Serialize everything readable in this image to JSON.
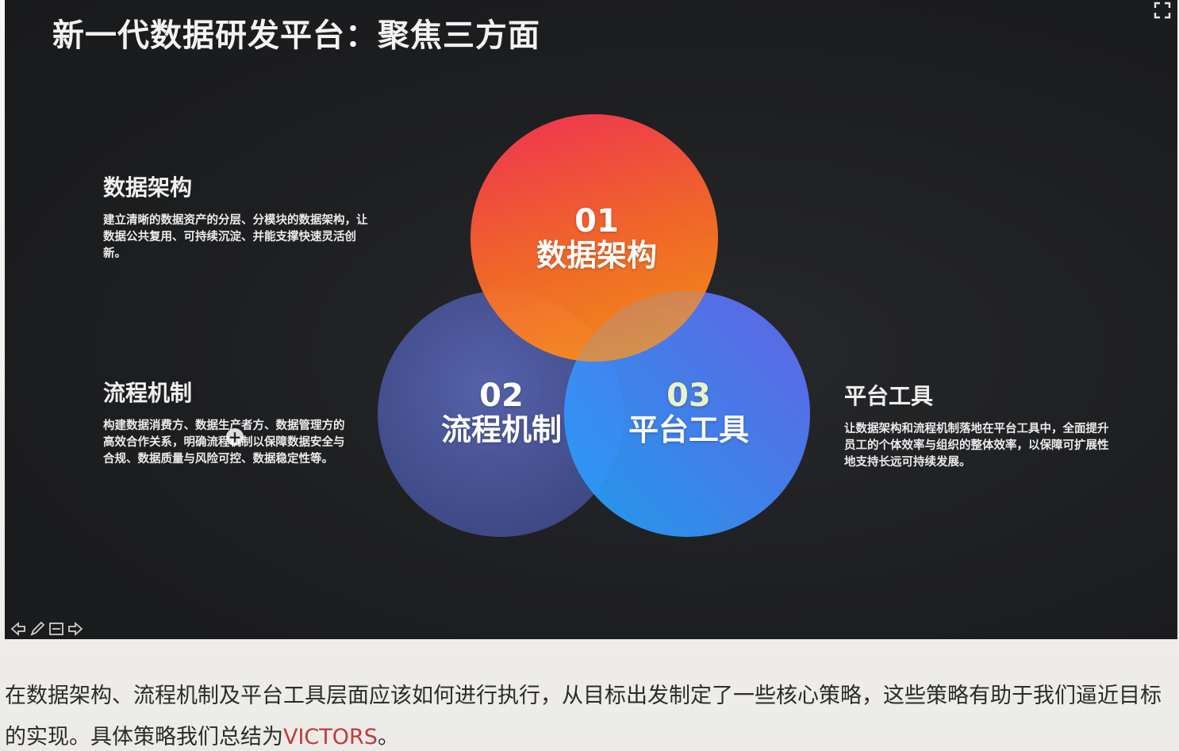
{
  "slide": {
    "title": "新一代数据研发平台：聚焦三方面",
    "blocks": {
      "arch": {
        "heading": "数据架构",
        "desc": "建立清晰的数据资产的分层、分模块的数据架构，让数据公共复用、可持续沉淀、并能支撑快速灵活创新。"
      },
      "proc": {
        "heading": "流程机制",
        "desc": "构建数据消费方、数据生产者方、数据管理方的高效合作关系，明确流程机制以保障数据安全与合规、数据质量与风险可控、数据稳定性等。"
      },
      "plat": {
        "heading": "平台工具",
        "desc": "让数据架构和流程机制落地在平台工具中，全面提升员工的个体效率与组织的整体效率，以保障可扩展性地支持长远可持续发展。"
      }
    },
    "circles": [
      {
        "num": "01",
        "name": "数据架构",
        "color_from": "#ff3b4e",
        "color_to": "#ff8a1e"
      },
      {
        "num": "02",
        "name": "流程机制",
        "color_from": "#3d4a8c",
        "color_to": "#6f7fd0"
      },
      {
        "num": "03",
        "name": "平台工具",
        "color_from": "#2aa7ff",
        "color_to": "#6c6cf5"
      }
    ],
    "cursor_glyph": "+",
    "nav_icons": [
      "prev-arrow-icon",
      "pen-icon",
      "menu-icon",
      "next-arrow-icon"
    ]
  },
  "caption": {
    "text": "在数据架构、流程机制及平台工具层面应该如何进行执行，从目标出发制定了一些核心策略，这些策略有助于我们逼近目标的实现。具体策略我们总结为",
    "highlight": "VICTORS",
    "suffix": "。"
  },
  "colors": {
    "slide_bg": "#1d1e20",
    "caption_text": "#2b2b2b",
    "highlight": "#c0393b"
  }
}
